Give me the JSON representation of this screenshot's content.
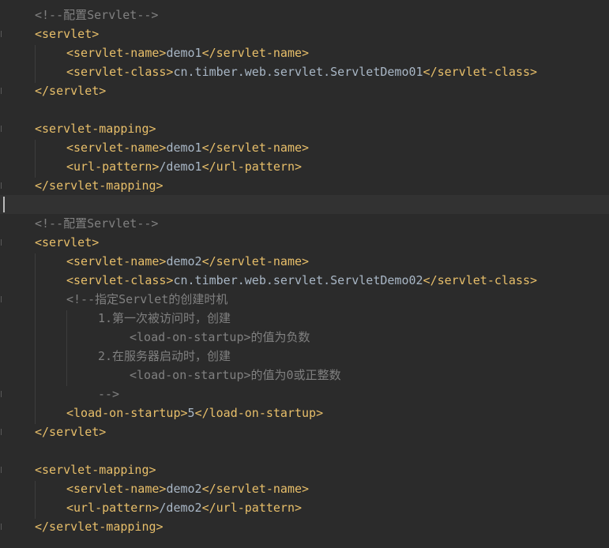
{
  "editor": {
    "language": "xml",
    "colors": {
      "background": "#2b2b2b",
      "current_line": "#323232",
      "tag": "#e8bf6a",
      "text": "#a9b7c6",
      "comment": "#808080"
    },
    "lines": {
      "l1": {
        "comment": "<!--配置Servlet-->"
      },
      "l2": {
        "open": "<servlet>"
      },
      "l3": {
        "open": "<servlet-name>",
        "text": "demo1",
        "close": "</servlet-name>"
      },
      "l4": {
        "open": "<servlet-class>",
        "text": "cn.timber.web.servlet.ServletDemo01",
        "close": "</servlet-class>"
      },
      "l5": {
        "close": "</servlet>"
      },
      "l7": {
        "open": "<servlet-mapping>"
      },
      "l8": {
        "open": "<servlet-name>",
        "text": "demo1",
        "close": "</servlet-name>"
      },
      "l9": {
        "open": "<url-pattern>",
        "text": "/demo1",
        "close": "</url-pattern>"
      },
      "l10": {
        "close": "</servlet-mapping>"
      },
      "l12": {
        "comment": "<!--配置Servlet-->"
      },
      "l13": {
        "open": "<servlet>"
      },
      "l14": {
        "open": "<servlet-name>",
        "text": "demo2",
        "close": "</servlet-name>"
      },
      "l15": {
        "open": "<servlet-class>",
        "text": "cn.timber.web.servlet.ServletDemo02",
        "close": "</servlet-class>"
      },
      "l16": {
        "comment": "<!--指定Servlet的创建时机"
      },
      "l17": {
        "comment": "1.第一次被访问时，创建"
      },
      "l18": {
        "comment_tag": "<load-on-startup>",
        "comment": "的值为负数"
      },
      "l19": {
        "comment": "2.在服务器启动时，创建"
      },
      "l20": {
        "comment_tag": "<load-on-startup>",
        "comment": "的值为0或正整数"
      },
      "l21": {
        "comment": "-->"
      },
      "l22": {
        "open": "<load-on-startup>",
        "text": "5",
        "close": "</load-on-startup>"
      },
      "l23": {
        "close": "</servlet>"
      },
      "l25": {
        "open": "<servlet-mapping>"
      },
      "l26": {
        "open": "<servlet-name>",
        "text": "demo2",
        "close": "</servlet-name>"
      },
      "l27": {
        "open": "<url-pattern>",
        "text": "/demo2",
        "close": "</url-pattern>"
      },
      "l28": {
        "close": "</servlet-mapping>"
      }
    }
  }
}
